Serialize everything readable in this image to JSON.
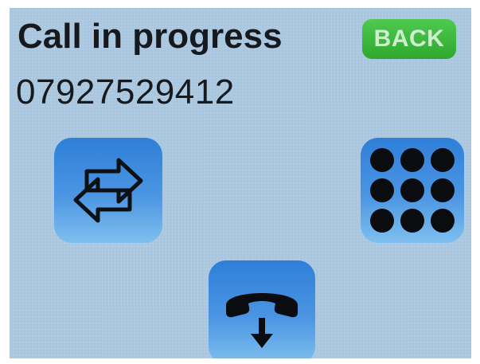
{
  "call": {
    "status": "Call in progress",
    "number": "07927529412"
  },
  "buttons": {
    "back_label": "BACK",
    "swap_icon": "swap-arrows-icon",
    "keypad_icon": "keypad-icon",
    "hangup_icon": "hang-up-icon"
  },
  "colors": {
    "background": "#a8c6de",
    "back_button": "#35b035",
    "icon_button": "#3a88dd",
    "text": "#161a1f"
  }
}
